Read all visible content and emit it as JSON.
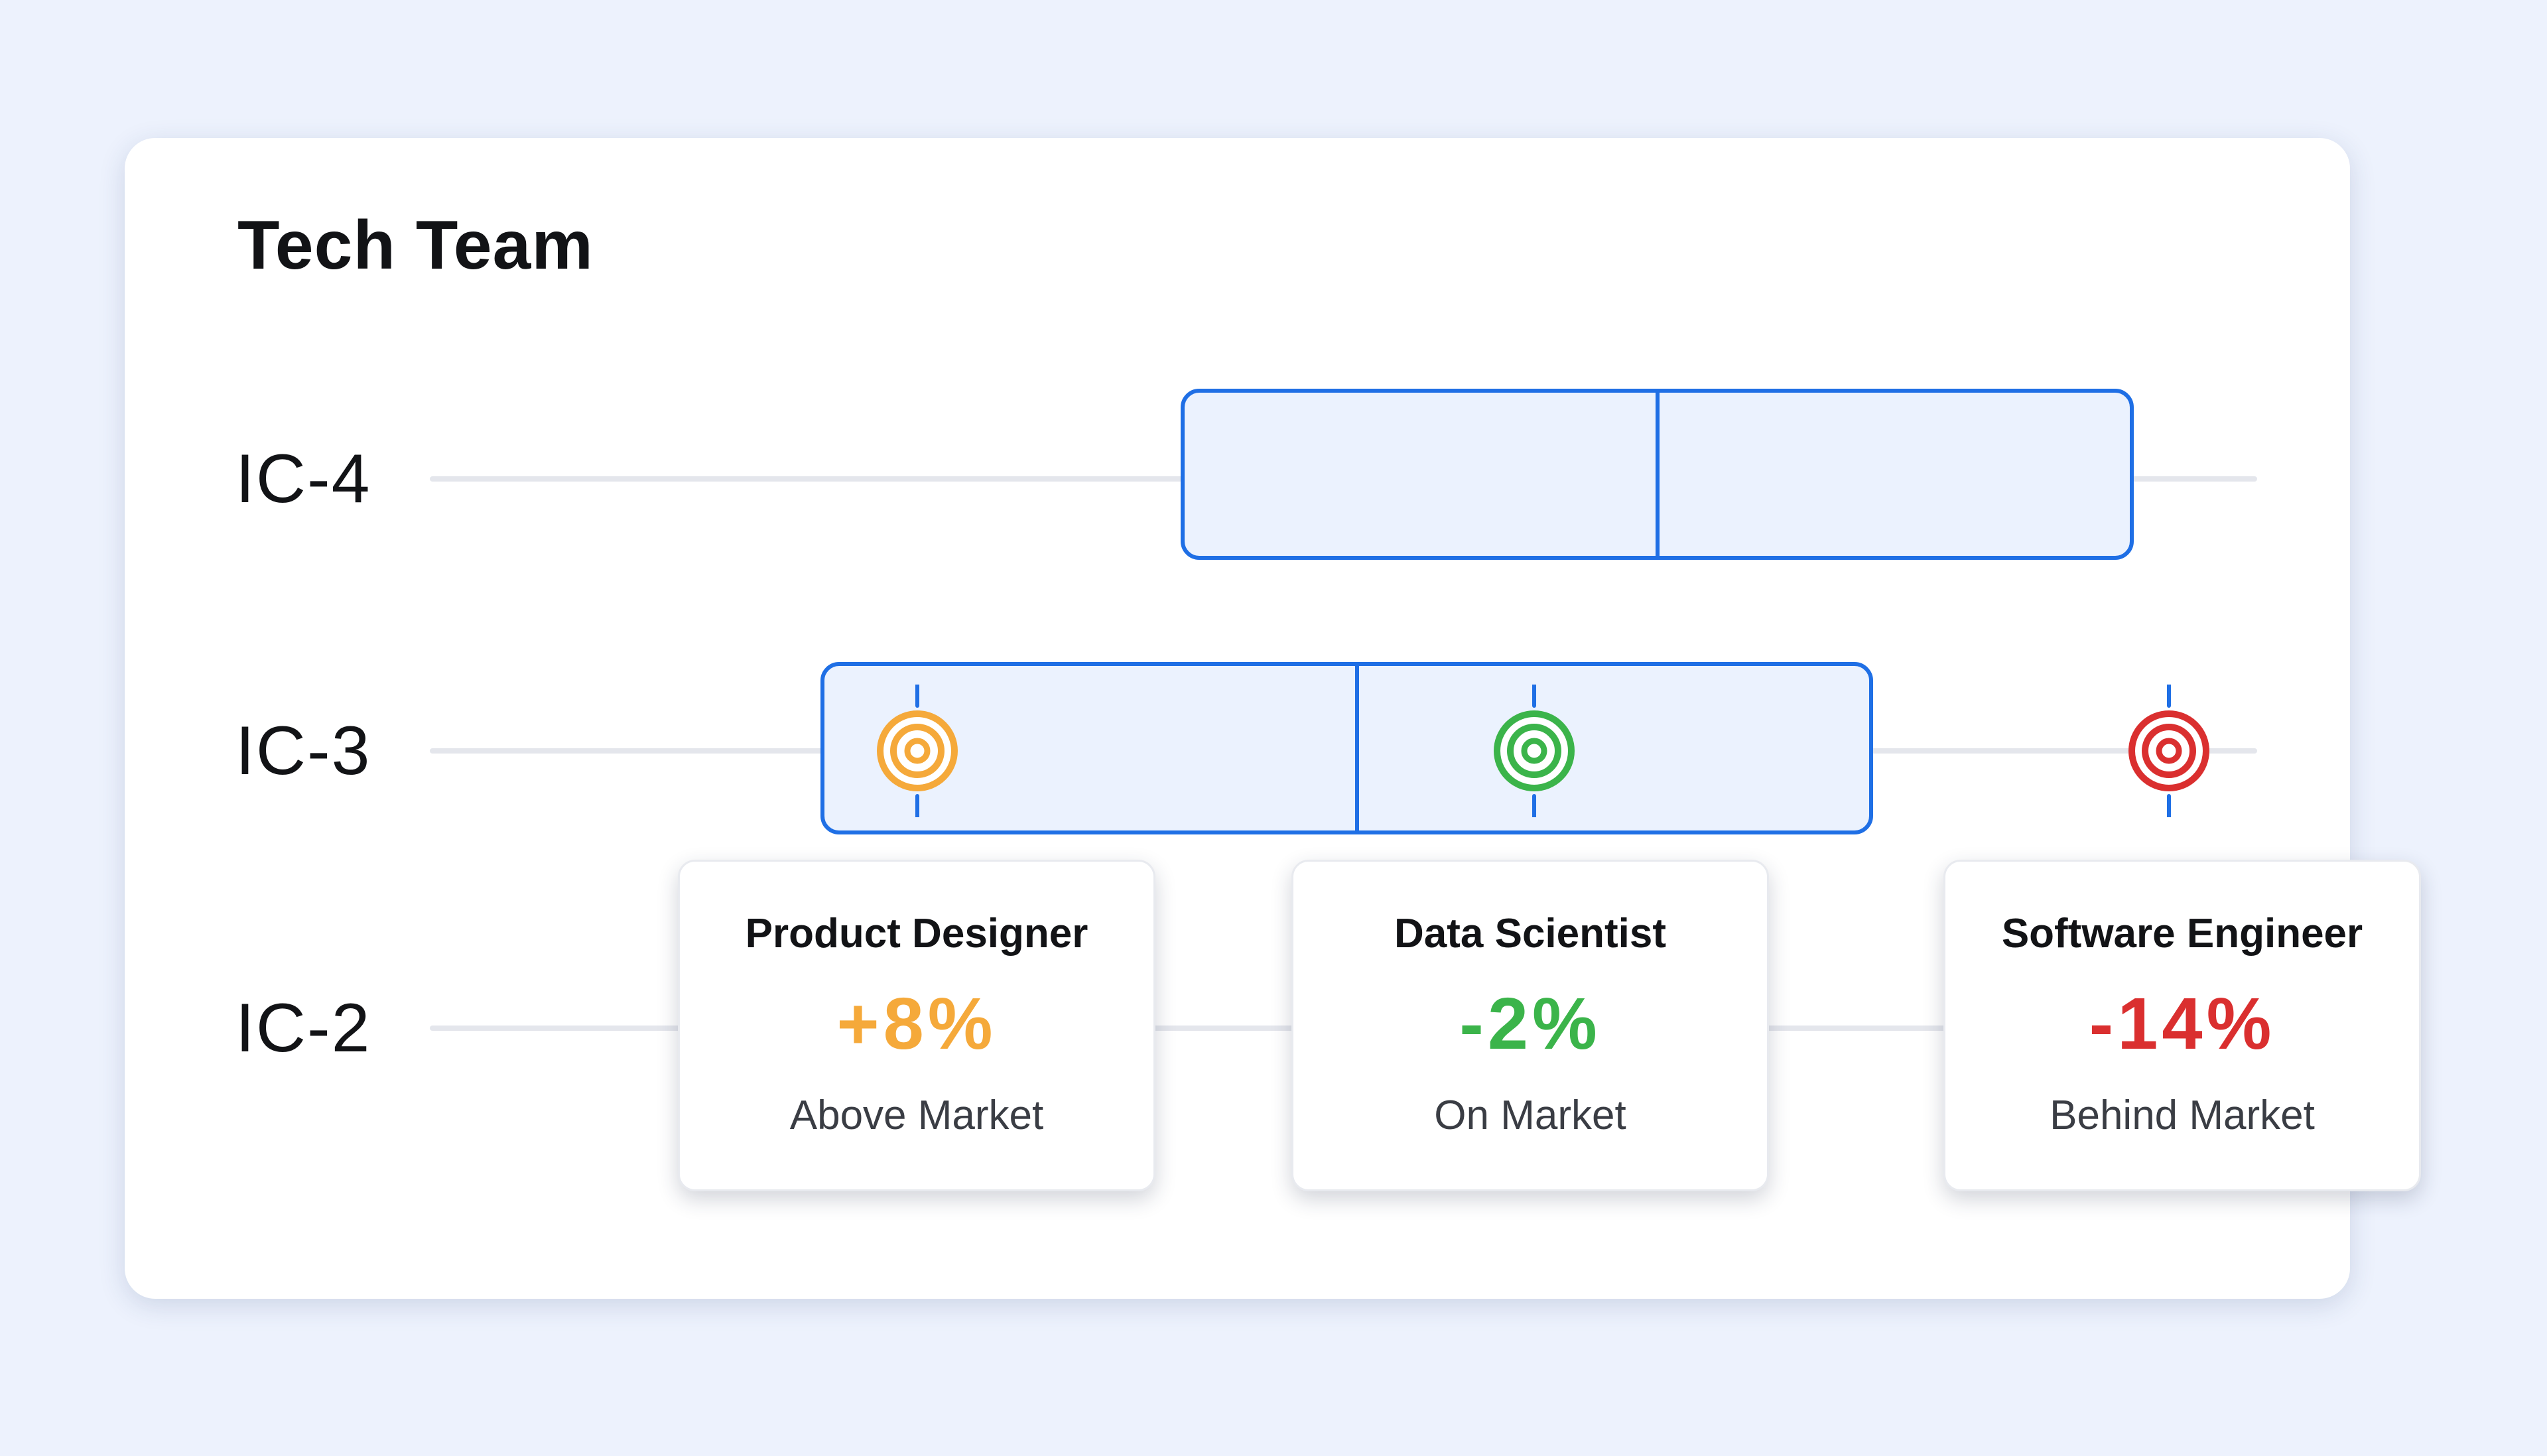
{
  "card": {
    "title": "Tech Team"
  },
  "levels": [
    {
      "label": "IC-4"
    },
    {
      "label": "IC-3"
    },
    {
      "label": "IC-2"
    }
  ],
  "roles": [
    {
      "name": "Product Designer",
      "delta": "+8%",
      "status": "Above Market",
      "color": "#f5a93a"
    },
    {
      "name": "Data Scientist",
      "delta": "-2%",
      "status": "On Market",
      "color": "#3bb44a"
    },
    {
      "name": "Software Engineer",
      "delta": "-14%",
      "status": "Behind Market",
      "color": "#da2f2f"
    }
  ],
  "icons": {
    "target": "target-icon"
  },
  "colors": {
    "band_border": "#1f6fe5",
    "band_fill": "#ebf2fe",
    "above_market": "#f5a93a",
    "on_market": "#3bb44a",
    "behind_market": "#da2f2f"
  }
}
